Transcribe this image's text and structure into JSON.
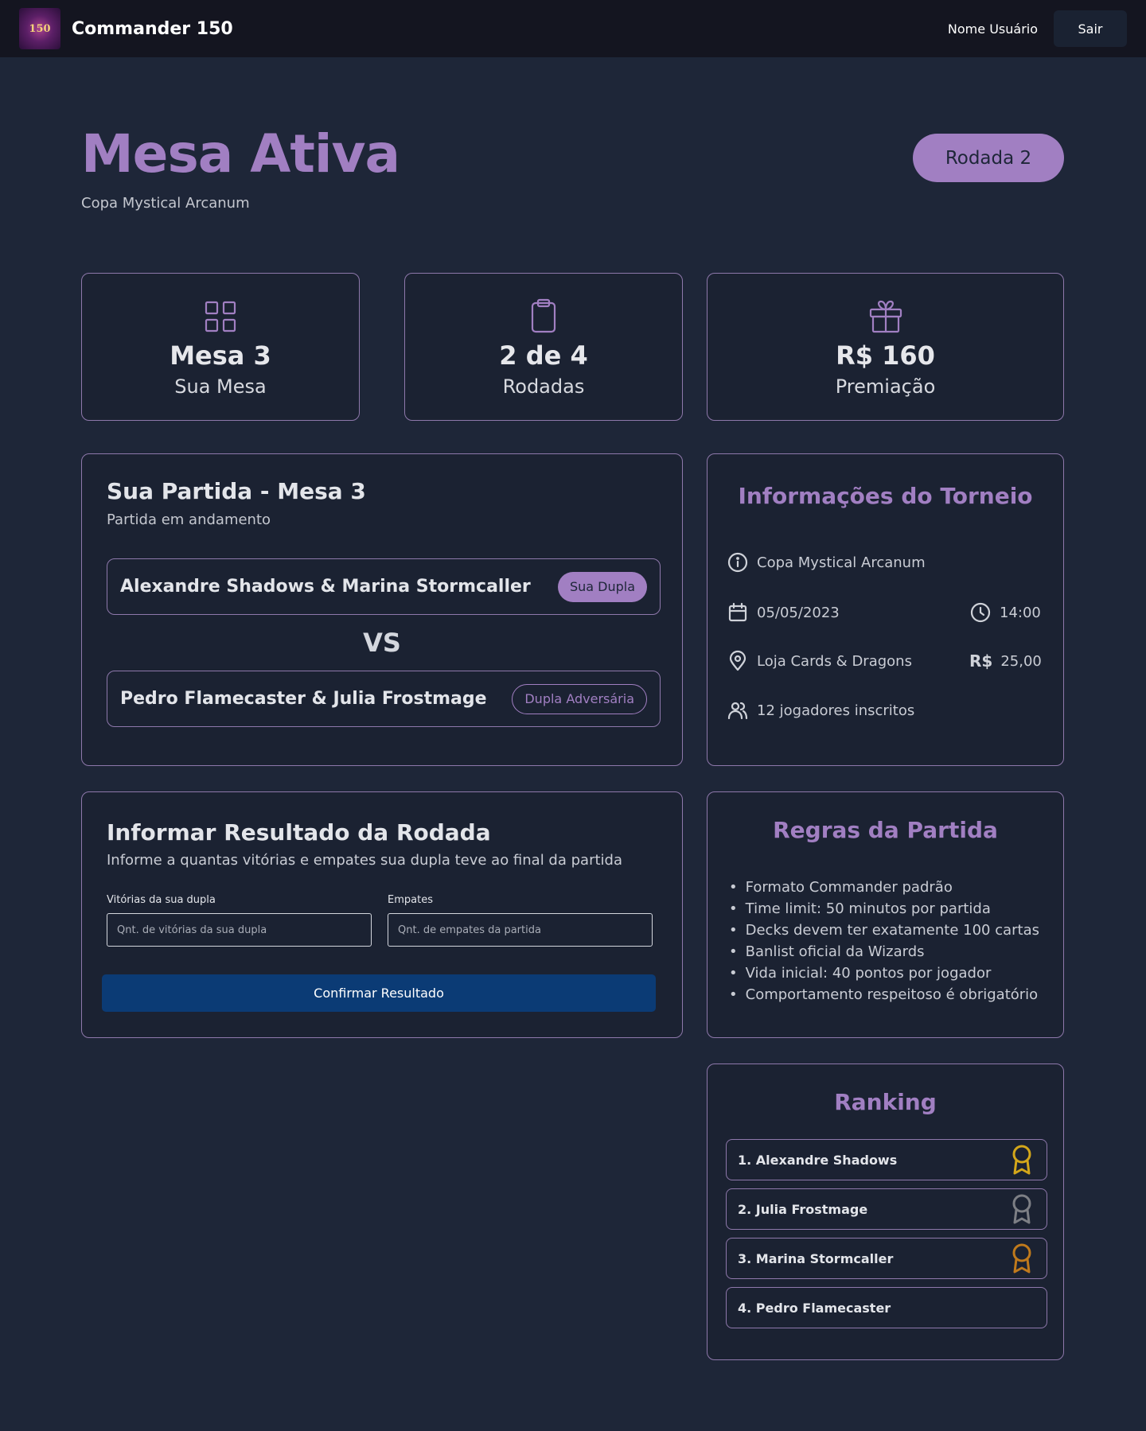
{
  "navbar": {
    "logo_text": "150",
    "app_title": "Commander 150",
    "username": "Nome Usuário",
    "logout_label": "Sair"
  },
  "header": {
    "title": "Mesa Ativa",
    "subtitle": "Copa Mystical Arcanum",
    "round_label": "Rodada 2"
  },
  "stats": [
    {
      "icon": "grid-icon",
      "value": "Mesa 3",
      "label": "Sua Mesa"
    },
    {
      "icon": "clipboard-icon",
      "value": "2 de 4",
      "label": "Rodadas"
    },
    {
      "icon": "gift-icon",
      "value": "R$ 160",
      "label": "Premiação"
    }
  ],
  "match": {
    "title": "Sua Partida - Mesa 3",
    "status": "Partida em andamento",
    "team_own": {
      "name": "Alexandre Shadows & Marina Stormcaller",
      "tag": "Sua Dupla"
    },
    "vs": "VS",
    "team_opponent": {
      "name": "Pedro Flamecaster & Julia Frostmage",
      "tag": "Dupla Adversária"
    }
  },
  "tournament_info": {
    "title": "Informações do Torneio",
    "name": "Copa Mystical Arcanum",
    "date": "05/05/2023",
    "time": "14:00",
    "location": "Loja Cards & Dragons",
    "currency_symbol": "R$",
    "fee": "25,00",
    "players": "12 jogadores inscritos"
  },
  "result_form": {
    "title": "Informar Resultado da Rodada",
    "subtitle": "Informe a quantas vitórias e empates sua dupla teve ao final da partida",
    "wins_label": "Vitórias da sua dupla",
    "wins_placeholder": "Qnt. de vitórias da sua dupla",
    "draws_label": "Empates",
    "draws_placeholder": "Qnt. de empates da partida",
    "confirm_label": "Confirmar Resultado"
  },
  "rules": {
    "title": "Regras da Partida",
    "items": [
      "Formato Commander padrão",
      "Time limit: 50 minutos por partida",
      "Decks devem ter exatamente 100 cartas",
      "Banlist oficial da Wizards",
      "Vida inicial: 40 pontos por jogador",
      "Comportamento respeitoso é obrigatório"
    ]
  },
  "ranking": {
    "title": "Ranking",
    "items": [
      {
        "label": "1. Alexandre Shadows",
        "medal_color": "#d4a71a"
      },
      {
        "label": "2. Julia Frostmage",
        "medal_color": "#7d7f85"
      },
      {
        "label": "3. Marina Stormcaller",
        "medal_color": "#c07a1c"
      },
      {
        "label": "4. Pedro Flamecaster",
        "medal_color": ""
      }
    ]
  },
  "colors": {
    "accent": "#a17fc2",
    "background": "#1e2638",
    "navbar": "#141520",
    "primary_button": "#0b3b75"
  }
}
